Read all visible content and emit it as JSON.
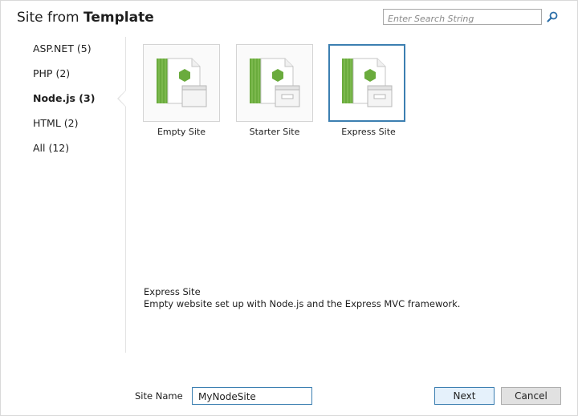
{
  "dialog": {
    "title_prefix": "Site from",
    "title_bold": "Template",
    "search_placeholder": "Enter Search String",
    "search_icon": "search-icon"
  },
  "sidebar": {
    "items": [
      {
        "label": "ASP.NET (5)",
        "active": false
      },
      {
        "label": "PHP (2)",
        "active": false
      },
      {
        "label": "Node.js (3)",
        "active": true
      },
      {
        "label": "HTML (2)",
        "active": false
      },
      {
        "label": "All (12)",
        "active": false
      }
    ]
  },
  "templates": {
    "items": [
      {
        "label": "Empty Site",
        "icon": "node-template-icon",
        "selected": false
      },
      {
        "label": "Starter Site",
        "icon": "node-template-icon",
        "selected": false
      },
      {
        "label": "Express Site",
        "icon": "node-template-icon",
        "selected": true
      }
    ]
  },
  "description": {
    "title": "Express Site",
    "text": "Empty website set up with Node.js and the Express MVC framework."
  },
  "footer": {
    "site_name_label": "Site Name",
    "site_name_value": "MyNodeSite",
    "next_label": "Next",
    "cancel_label": "Cancel"
  },
  "colors": {
    "accent": "#3c7fb1",
    "node_green": "#6aab3d",
    "node_green_dark": "#3f7f1f",
    "selected_button_bg": "#e5f1fb"
  }
}
